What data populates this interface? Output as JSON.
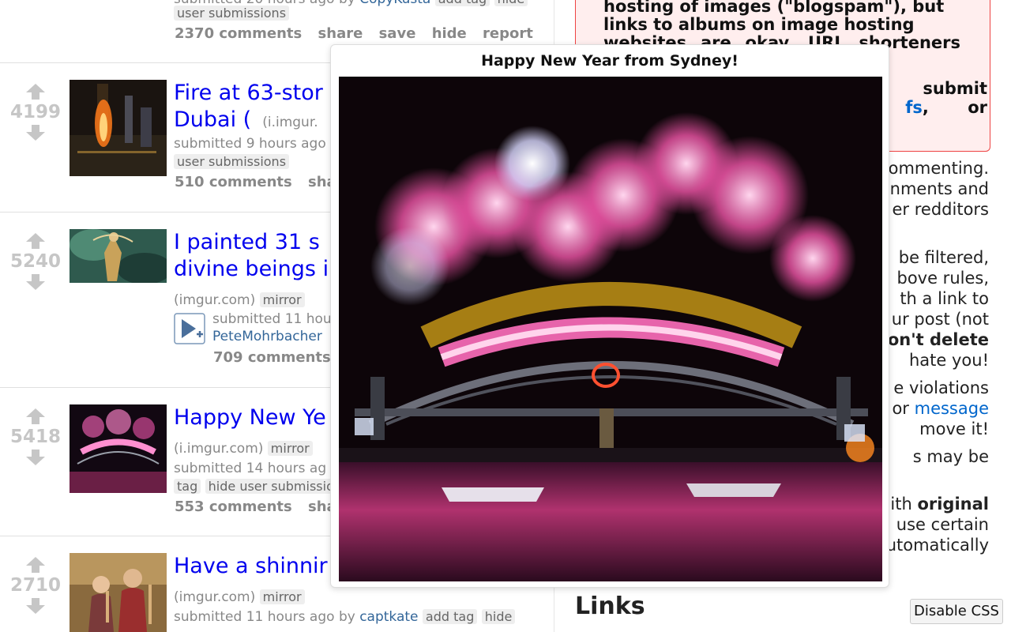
{
  "posts": [
    {
      "meta_line": "submitted 20 hours ago by",
      "author": "CopyKusta",
      "tags": [
        "add tag",
        "hide"
      ],
      "tag_line2": "user submissions",
      "buttons": [
        "2370 comments",
        "share",
        "save",
        "hide",
        "report"
      ]
    },
    {
      "score": "4199",
      "title": "Fire at 63-stor",
      "title_line2": "Dubai (",
      "domain": "(i.imgur.",
      "meta_line": "submitted 9 hours ago",
      "tag_line2": "user submissions",
      "buttons": [
        "510 comments",
        "sha"
      ]
    },
    {
      "score": "5240",
      "title": "I painted 31 s",
      "title_line2": "divine beings i",
      "domain": "(imgur.com)",
      "mirror": "mirror",
      "meta_line": "submitted 11 hou",
      "author": "PeteMohrbacher",
      "buttons": [
        "709 comments"
      ]
    },
    {
      "score": "5418",
      "title": "Happy New Ye",
      "domain": "(i.imgur.com)",
      "mirror": "mirror",
      "meta_line": "submitted 14 hours ag",
      "tag": "tag",
      "tag_line2": "hide user submissio",
      "buttons": [
        "553 comments",
        "sha"
      ]
    },
    {
      "score": "2710",
      "title": "Have a shinnir",
      "domain": "(imgur.com)",
      "mirror": "mirror",
      "meta_line": "submitted 11 hours ago by",
      "author": "captkate",
      "tags": [
        "add tag",
        "hide"
      ]
    }
  ],
  "sidebar": {
    "rule_lines": [
      "hosting of images (\"blogspam\"), but",
      "links to albums on image hosting",
      "websites are okay. URL shorteners are"
    ],
    "rule_submit": "submit",
    "rule_fs": "fs",
    "rule_or": "or",
    "lines": [
      "ommenting.",
      "nments and",
      "er redditors",
      "be filtered,",
      "bove rules,",
      "th a link to",
      "ur post (not",
      "on't delete",
      "hate you!",
      "e violations",
      "or",
      "message",
      "move it!",
      "s may be",
      "ith",
      "original",
      "use certain",
      "utomatically"
    ],
    "links_heading": "Links"
  },
  "disable_css": "Disable CSS",
  "popup": {
    "title": "Happy New Year from Sydney!"
  },
  "colors": {
    "link_blue": "#0000ee",
    "score_gray": "#c6c6c6",
    "rule_bg": "#ffeeee",
    "rule_border": "#e44"
  }
}
